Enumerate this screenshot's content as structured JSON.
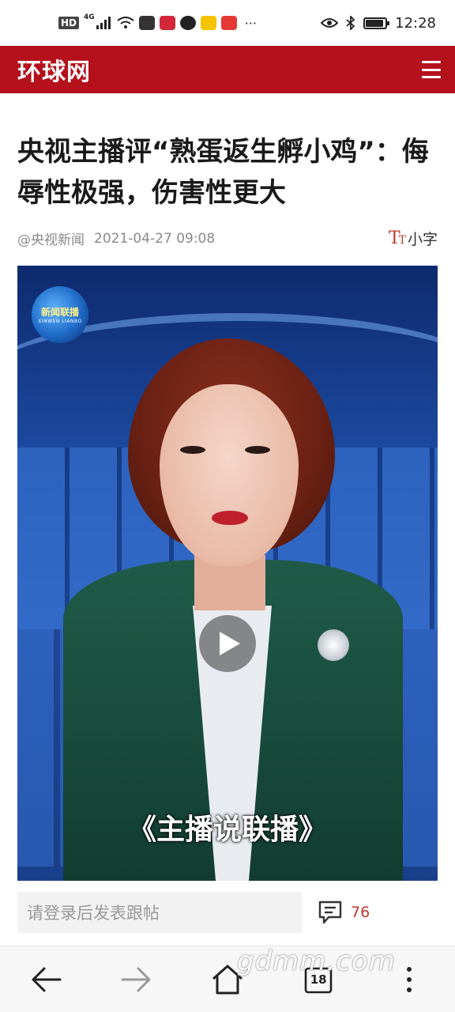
{
  "status_bar": {
    "network_label": "HD",
    "network_type": "4G",
    "time": "12:28",
    "battery_level": 0.85,
    "app_icons": [
      "sina-weibo-icon",
      "weibo-icon",
      "wechat-icon",
      "heart-app-icon",
      "news-app-icon"
    ],
    "more_indicator": "···"
  },
  "header": {
    "logo_text": "环球网",
    "brand_color": "#b5111c"
  },
  "article": {
    "title": "央视主播评“熟蛋返生孵小鸡”：侮辱性极强，伤害性更大",
    "source": "@央视新闻",
    "date": "2021-04-27 09:08",
    "font_size_label": "小字",
    "font_size_icon_text": "T"
  },
  "video": {
    "channel_logo": "新闻联播",
    "channel_logo_sub": "XINWEN LIANBO",
    "caption": "《主播说联播》"
  },
  "comment_bar": {
    "placeholder": "请登录后发表跟帖",
    "comment_count": "76"
  },
  "bottom_nav": {
    "tab_count": "18"
  },
  "watermark": "gdmm.com"
}
